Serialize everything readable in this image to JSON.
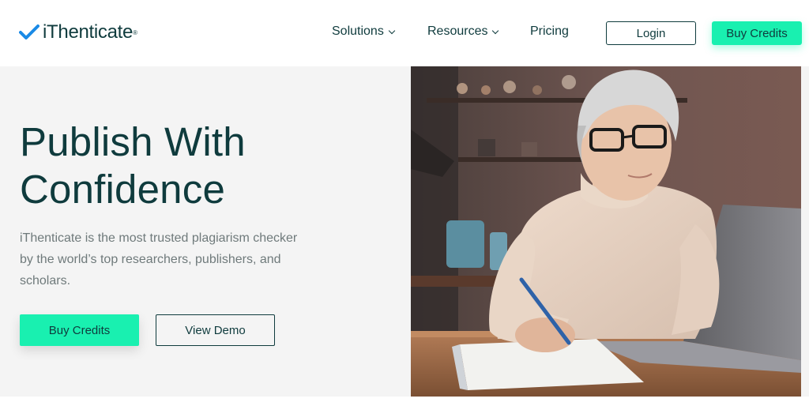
{
  "brand": {
    "name": "iThenticate",
    "reg_mark": "®",
    "accent": "#19f0b0",
    "primary": "#0f3b3d",
    "check_color": "#1a8ae6"
  },
  "nav": {
    "items": [
      {
        "label": "Solutions",
        "icon": "chevron-down-icon"
      },
      {
        "label": "Resources",
        "icon": "chevron-down-icon"
      },
      {
        "label": "Pricing"
      }
    ],
    "login_label": "Login",
    "buy_label": "Buy Credits"
  },
  "hero": {
    "title_line1": "Publish With",
    "title_line2": "Confidence",
    "subtitle": "iThenticate is the most trusted plagiarism checker by the world’s top researchers, publishers, and scholars.",
    "primary_cta": "Buy Credits",
    "secondary_cta": "View Demo",
    "background": "#f4f4f4"
  },
  "image": {
    "subject": "woman-writing-at-laptop-photo"
  }
}
